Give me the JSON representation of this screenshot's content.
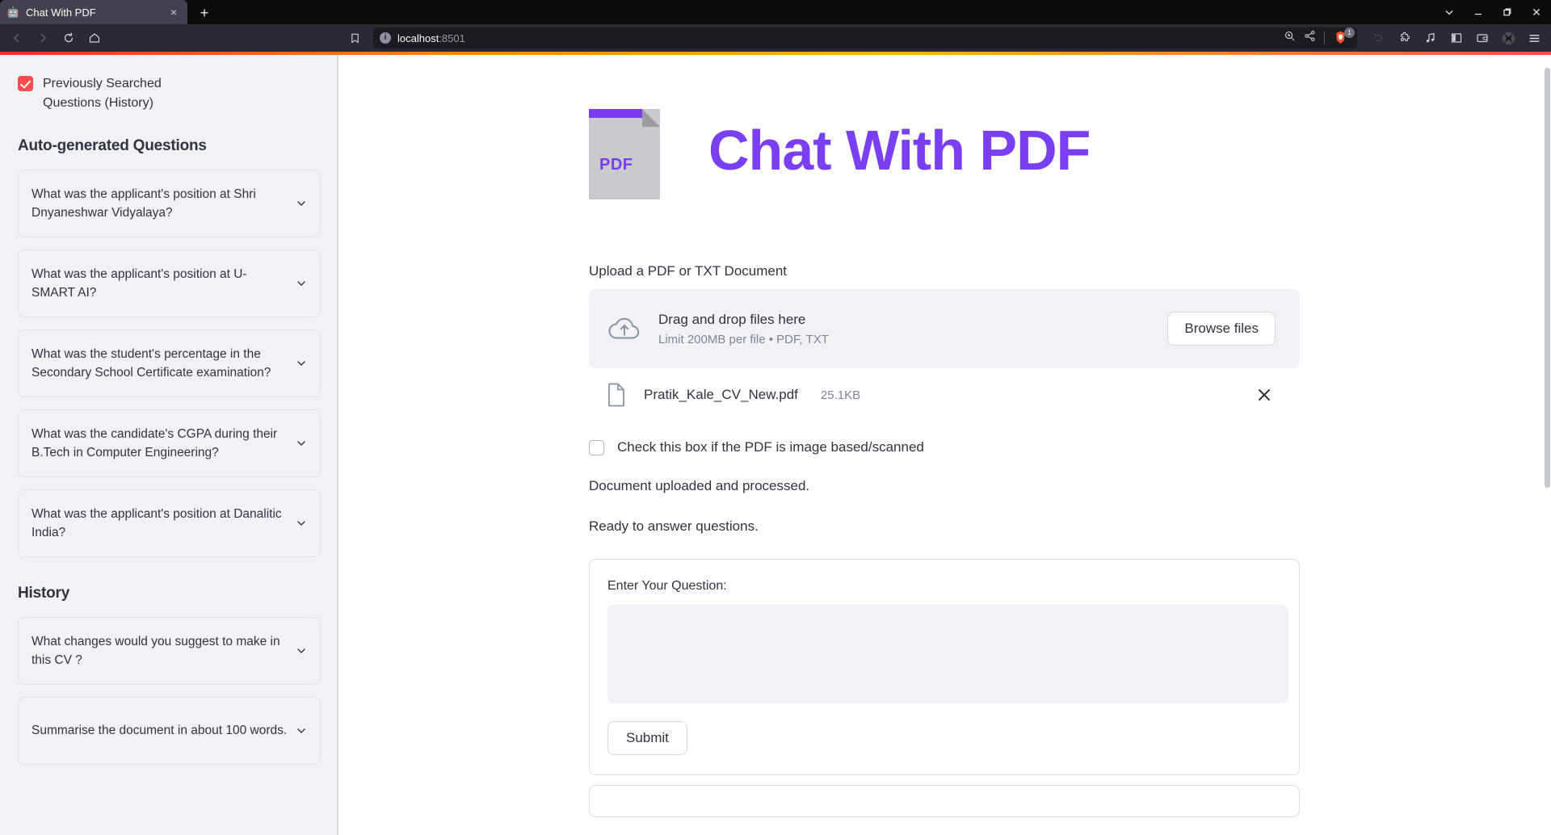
{
  "browser": {
    "tab": {
      "title": "Chat With PDF",
      "favicon": "robot-icon",
      "close": "×"
    },
    "new_tab_label": "+",
    "window_controls": [
      "list-all-tabs-icon",
      "minimize-icon",
      "restore-icon",
      "close-icon"
    ],
    "nav_icons": [
      "back-icon",
      "forward-icon",
      "reload-icon",
      "home-icon"
    ],
    "url": {
      "host": "localhost",
      "port": ":8501",
      "shield": "i"
    },
    "url_right_icons": [
      "zoom-in-icon",
      "share-icon"
    ],
    "extension_badge_count": "1",
    "toolbar_right_icons": [
      "sync-icon",
      "extensions-puzzle-icon",
      "music-icon",
      "sidebar-icon",
      "wallet-icon",
      "brave-shields-icon",
      "menu-icon"
    ]
  },
  "sidebar": {
    "history_checkbox": {
      "label": "Previously Searched Questions (History)",
      "checked": true,
      "accent": "#ff4b4b"
    },
    "auto_heading": "Auto-generated Questions",
    "auto_questions": [
      "What was the applicant's position at Shri Dnyaneshwar Vidyalaya?",
      "What was the applicant's position at U-SMART AI?",
      "What was the student's percentage in the Secondary School Certificate examination?",
      "What was the candidate's CGPA during their B.Tech in Computer Engineering?",
      "What was the applicant's position at Danalitic India?"
    ],
    "history_heading": "History",
    "history_questions": [
      "What changes would you suggest to make in this CV ?",
      "Summarise the document in about 100 words."
    ]
  },
  "main": {
    "brand": {
      "title": "Chat With PDF",
      "logo_word": "PDF",
      "accent": "#7b3ff2"
    },
    "uploader_label": "Upload a PDF or TXT Document",
    "dropzone": {
      "headline": "Drag and drop files here",
      "limit": "Limit 200MB per file • PDF, TXT",
      "browse_label": "Browse files"
    },
    "uploaded_file": {
      "name": "Pratik_Kale_CV_New.pdf",
      "size": "25.1KB",
      "remove_label": "✕"
    },
    "scanned_checkbox": {
      "label": "Check this box if the PDF is image based/scanned",
      "checked": false
    },
    "status_messages": [
      "Document uploaded and processed.",
      "Ready to answer questions."
    ],
    "question_form": {
      "label": "Enter Your Question:",
      "value": "",
      "placeholder": "",
      "submit_label": "Submit"
    }
  }
}
